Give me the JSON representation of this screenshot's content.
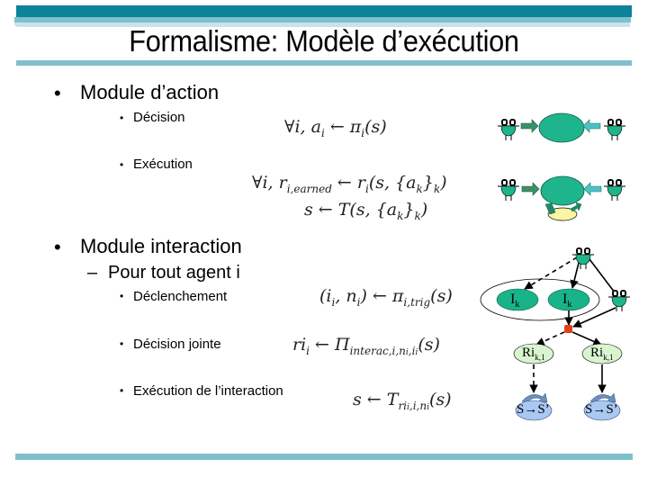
{
  "slide": {
    "title": "Formalisme: Modèle d’exécution",
    "accent_colors": {
      "dark_band": "#0b8399",
      "mid_band": "#7fc0cc",
      "light_band": "#c7e4ea"
    }
  },
  "sections": {
    "action": {
      "bullet": "•",
      "heading": "Module d’action",
      "items": [
        {
          "bullet": "•",
          "label": "Décision",
          "formula": [
            "∀i, a",
            "i",
            " ← π",
            "i",
            "(s)"
          ]
        },
        {
          "bullet": "•",
          "label": "Exécution",
          "formula_line1": [
            "∀i, r",
            "i,earned",
            " ← r",
            "i",
            "(s, {a",
            "k",
            "}",
            "k",
            ")"
          ],
          "formula_line2": [
            "s ← T(s, {a",
            "k",
            "}",
            "k",
            ")"
          ]
        }
      ]
    },
    "interaction": {
      "bullet": "•",
      "heading": "Module interaction",
      "sub_dash": "–",
      "sub_heading": "Pour tout agent i",
      "items": [
        {
          "bullet": "•",
          "label": "Déclenchement",
          "formula": [
            "(i",
            "i",
            ", n",
            "i",
            ") ← π",
            "i,trig",
            "(s)"
          ]
        },
        {
          "bullet": "•",
          "label": "Décision jointe",
          "formula": [
            "ri",
            "i",
            " ← Π",
            "interac,i,n",
            "i",
            ",i",
            "i",
            "(s)"
          ]
        },
        {
          "bullet": "•",
          "label": "Exécution de l’interaction",
          "formula": [
            "s ← T",
            "ri",
            "i",
            ",i,n",
            "i",
            "(s)"
          ]
        }
      ]
    }
  },
  "diagram": {
    "action_decision": {
      "icons": [
        "agent-icon",
        "arrow-right-icon",
        "action-ellipse",
        "arrow-left-icon",
        "agent-icon"
      ]
    },
    "action_execution": {
      "icons": [
        "agent-icon",
        "arrow-right-icon",
        "action-ellipse",
        "arrow-left-icon",
        "agent-icon",
        "cycle-arrows-icon"
      ]
    },
    "interaction": {
      "interaction_node_1": {
        "main": "I",
        "sub": "k"
      },
      "interaction_node_2": {
        "main": "I",
        "sub": "k"
      },
      "result_node_1": {
        "main": "Ri",
        "sub": "k,1"
      },
      "result_node_2": {
        "main": "Ri",
        "sub": "k,1"
      },
      "transition_1": {
        "from": "S",
        "arrow": "→",
        "to": "S’"
      },
      "transition_2": {
        "from": "S",
        "arrow": "→",
        "to": "S’"
      },
      "colors": {
        "agent": "#1fb58c",
        "interaction": "#19b389",
        "result": "#d8f5cf",
        "transition": "#a9c8f2",
        "junction": "#e2401a"
      }
    }
  }
}
